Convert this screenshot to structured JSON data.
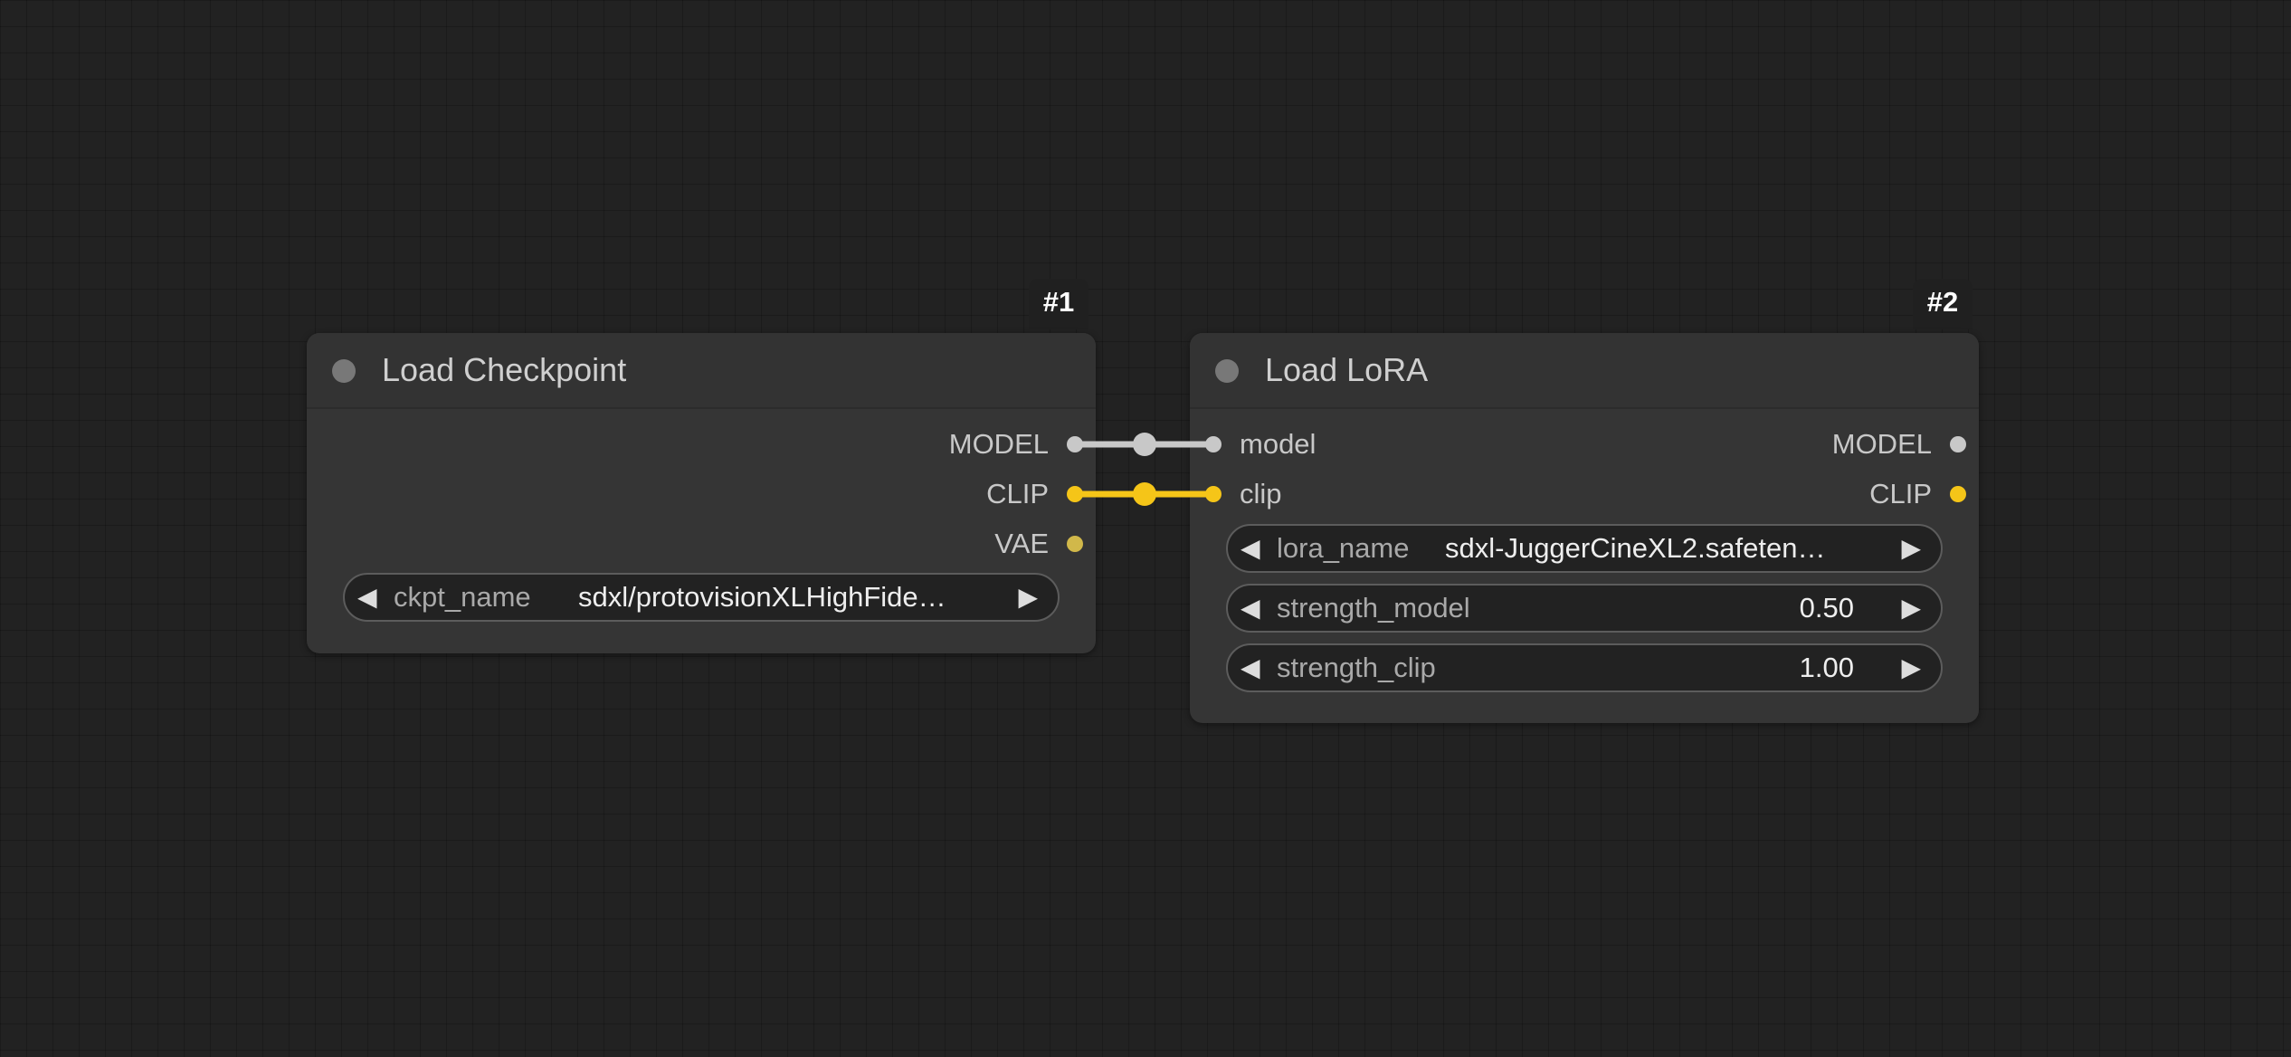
{
  "nodes": [
    {
      "id": "#1",
      "title": "Load Checkpoint",
      "outputs": [
        "MODEL",
        "CLIP",
        "VAE"
      ],
      "widgets": [
        {
          "name": "ckpt_name",
          "value": "sdxl/protovisionXLHighFide…"
        }
      ]
    },
    {
      "id": "#2",
      "title": "Load LoRA",
      "inputs": [
        "model",
        "clip"
      ],
      "outputs": [
        "MODEL",
        "CLIP"
      ],
      "widgets": [
        {
          "name": "lora_name",
          "value": "sdxl-JuggerCineXL2.safeten…"
        },
        {
          "name": "strength_model",
          "value": "0.50"
        },
        {
          "name": "strength_clip",
          "value": "1.00"
        }
      ]
    }
  ],
  "widget_arrows": {
    "left": "◀",
    "right": "▶"
  },
  "colors": {
    "canvas_bg": "#222222",
    "node_bg": "#353535",
    "model_link": "#c8c8c8",
    "clip_link": "#f5c518",
    "vae_slot": "#d1b84a"
  },
  "links": [
    {
      "from": "#1.MODEL",
      "to": "#2.model",
      "type": "MODEL"
    },
    {
      "from": "#1.CLIP",
      "to": "#2.clip",
      "type": "CLIP"
    }
  ]
}
